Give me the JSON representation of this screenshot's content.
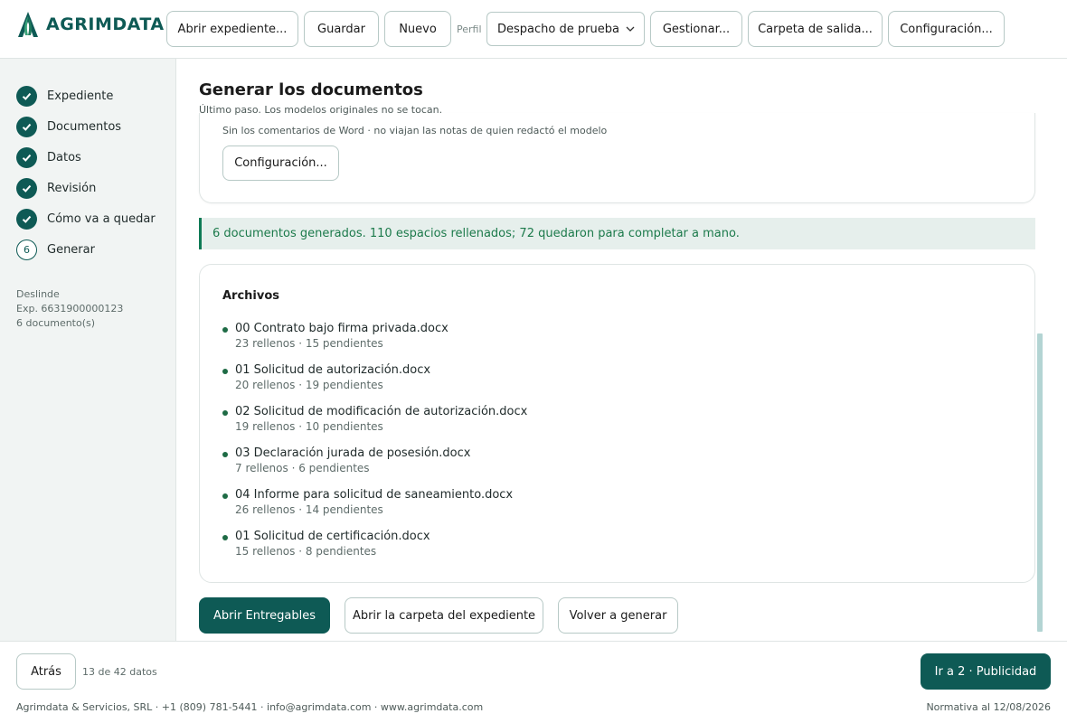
{
  "app": {
    "name": "AGRIMDATA"
  },
  "toolbar": {
    "open_label": "Abrir expediente...",
    "save_label": "Guardar",
    "new_label": "Nuevo",
    "profile_label": "Perfil",
    "profile_value": "Despacho de prueba",
    "manage_label": "Gestionar...",
    "output_label": "Carpeta de salida...",
    "settings_label": "Configuración..."
  },
  "sidebar": {
    "steps": [
      {
        "label": "Expediente",
        "status": "done"
      },
      {
        "label": "Documentos",
        "status": "done"
      },
      {
        "label": "Datos",
        "status": "done"
      },
      {
        "label": "Revisión",
        "status": "done"
      },
      {
        "label": "Cómo va a quedar",
        "status": "done"
      },
      {
        "label": "Generar",
        "status": "current",
        "number": "6"
      }
    ],
    "meta": {
      "type": "Deslinde",
      "file": "Exp. 6631900000123",
      "docs": "6 documento(s)"
    }
  },
  "main": {
    "title": "Generar los documentos",
    "subtitle": "Último paso. Los modelos originales no se tocan.",
    "options_note": "Sin los comentarios de Word · no viajan las notas de quien redactó el modelo",
    "options_button": "Configuración...",
    "banner": "6 documentos generados. 110 espacios rellenados; 72 quedaron para completar a mano.",
    "files_title": "Archivos",
    "files": [
      {
        "name": "00 Contrato bajo firma privada.docx",
        "stats": "23 rellenos · 15 pendientes"
      },
      {
        "name": "01 Solicitud de autorización.docx",
        "stats": "20 rellenos · 19 pendientes"
      },
      {
        "name": "02 Solicitud de modificación de autorización.docx",
        "stats": "19 rellenos · 10 pendientes"
      },
      {
        "name": "03 Declaración jurada de posesión.docx",
        "stats": "7 rellenos · 6 pendientes"
      },
      {
        "name": "04 Informe para solicitud de saneamiento.docx",
        "stats": "26 rellenos · 14 pendientes"
      },
      {
        "name": "01 Solicitud de certificación.docx",
        "stats": "15 rellenos · 8 pendientes"
      }
    ],
    "actions": {
      "open_deliverables": "Abrir Entregables",
      "open_folder": "Abrir la carpeta del expediente",
      "regenerate": "Volver a generar"
    }
  },
  "footer": {
    "back_label": "Atrás",
    "count": "13 de 42 datos",
    "next_label": "Ir a 2 · Publicidad",
    "contact": "Agrimdata & Servicios, SRL · +1 (809) 781-5441 · info@agrimdata.com · www.agrimdata.com",
    "normativa": "Normativa al 12/08/2026"
  },
  "colors": {
    "brand": "#0e5a55",
    "success_text": "#1c7a4b",
    "banner_bg": "#e6efec"
  }
}
